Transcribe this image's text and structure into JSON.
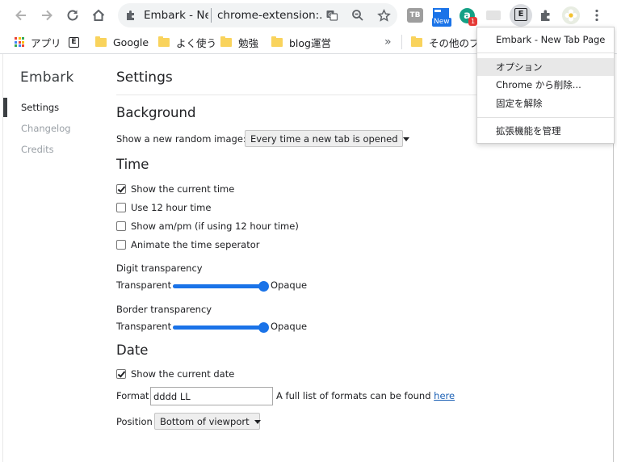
{
  "browser": {
    "tab_title": "Embark - Ne",
    "url": "chrome-extension:...",
    "extensions": {
      "tb_label": "TB",
      "new_badge": "New",
      "a_label": "a",
      "a_badge": "1",
      "embark_label": "E"
    }
  },
  "bookmarks": {
    "apps": "アプリ",
    "embark_label": "E",
    "items": [
      "Google",
      "よく使う",
      "勉強",
      "blog運営"
    ],
    "overflow": "»",
    "other": "その他のブッ"
  },
  "sidebar": {
    "brand": "Embark",
    "items": [
      {
        "label": "Settings",
        "active": true
      },
      {
        "label": "Changelog",
        "active": false
      },
      {
        "label": "Credits",
        "active": false
      }
    ]
  },
  "settings": {
    "title": "Settings",
    "background": {
      "heading": "Background",
      "random_label": "Show a new random image:",
      "random_value": "Every time a new tab is opened"
    },
    "time": {
      "heading": "Time",
      "options": [
        {
          "label": "Show the current time",
          "checked": true
        },
        {
          "label": "Use 12 hour time",
          "checked": false
        },
        {
          "label": "Show am/pm (if using 12 hour time)",
          "checked": false
        },
        {
          "label": "Animate the time seperator",
          "checked": false
        }
      ],
      "digit_transparency": {
        "label": "Digit transparency",
        "min_label": "Transparent",
        "max_label": "Opaque",
        "value": 1.0
      },
      "border_transparency": {
        "label": "Border transparency",
        "min_label": "Transparent",
        "max_label": "Opaque",
        "value": 1.0
      }
    },
    "date": {
      "heading": "Date",
      "show_date": {
        "label": "Show the current date",
        "checked": true
      },
      "format_label": "Format",
      "format_value": "dddd LL",
      "format_hint": "A full list of formats can be found",
      "format_link": "here",
      "position_label": "Position",
      "position_value": "Bottom of viewport"
    }
  },
  "menu": {
    "header": "Embark - New Tab Page",
    "items": [
      "オプション",
      "Chrome から削除...",
      "固定を解除"
    ],
    "manage": "拡張機能を管理"
  }
}
